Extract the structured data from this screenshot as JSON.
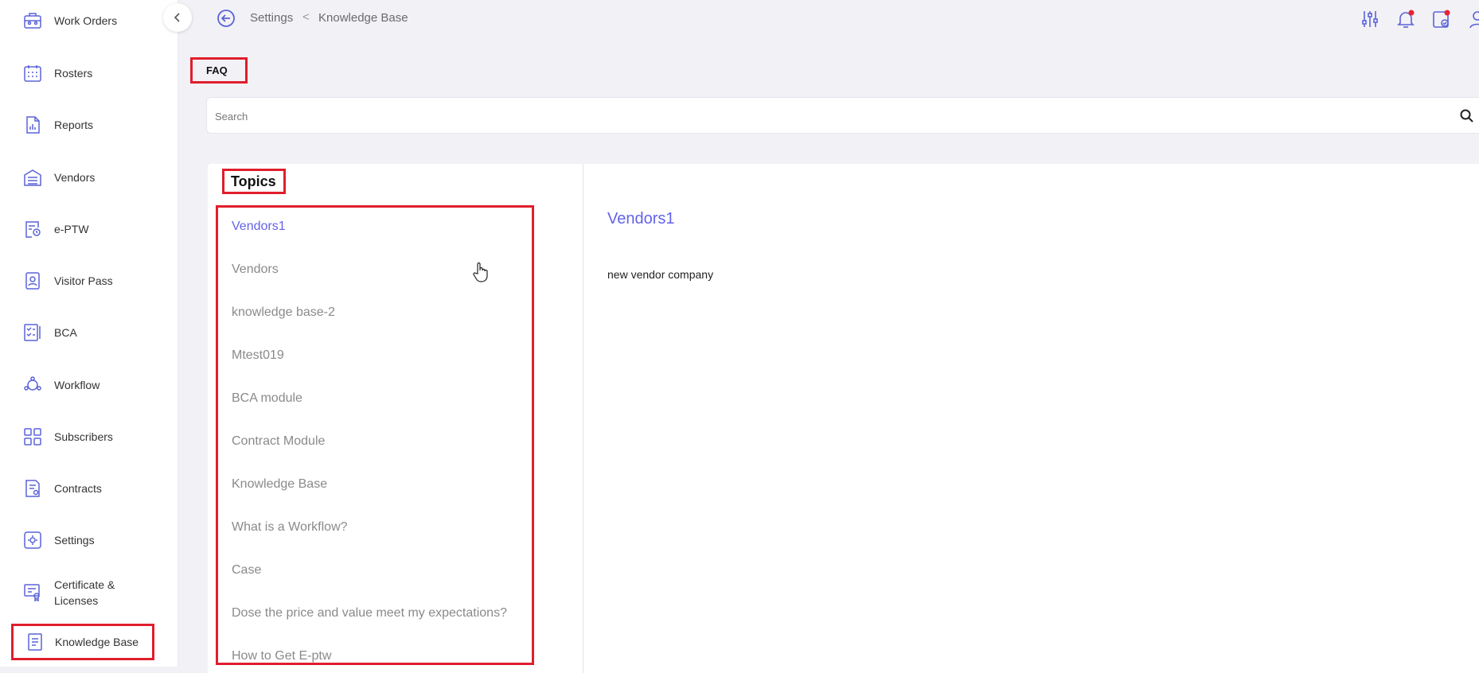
{
  "sidebar": {
    "items": [
      {
        "label": "Work Orders",
        "icon": "briefcase-icon"
      },
      {
        "label": "Rosters",
        "icon": "calendar-icon"
      },
      {
        "label": "Reports",
        "icon": "report-icon"
      },
      {
        "label": "Vendors",
        "icon": "warehouse-icon"
      },
      {
        "label": "e-PTW",
        "icon": "permit-icon"
      },
      {
        "label": "Visitor Pass",
        "icon": "badge-icon"
      },
      {
        "label": "BCA",
        "icon": "checklist-icon"
      },
      {
        "label": "Workflow",
        "icon": "workflow-icon"
      },
      {
        "label": "Subscribers",
        "icon": "grid-icon"
      },
      {
        "label": "Contracts",
        "icon": "contract-icon"
      },
      {
        "label": "Settings",
        "icon": "settings-icon"
      },
      {
        "label": "Certificate &",
        "label2": "Licenses",
        "icon": "certificate-icon"
      },
      {
        "label": "Knowledge Base",
        "icon": "knowledge-base-icon"
      }
    ]
  },
  "breadcrumb": {
    "parent": "Settings",
    "separator": "<",
    "current": "Knowledge Base"
  },
  "faq_label": "FAQ",
  "search": {
    "placeholder": "Search",
    "value": ""
  },
  "topics": {
    "heading": "Topics",
    "items": [
      "Vendors1",
      "Vendors",
      "knowledge base-2",
      "Mtest019",
      "BCA module",
      "Contract Module",
      "Knowledge Base",
      "What is a Workflow?",
      "Case",
      "Dose the price and value meet my expectations?",
      "How to Get E-ptw"
    ],
    "selected_index": 0
  },
  "detail": {
    "title": "Vendors1",
    "body": "new vendor company"
  },
  "colors": {
    "accent": "#6363e8",
    "highlight_border": "#e01e2c",
    "icon": "#5a63d8",
    "notification": "#e8232f"
  }
}
